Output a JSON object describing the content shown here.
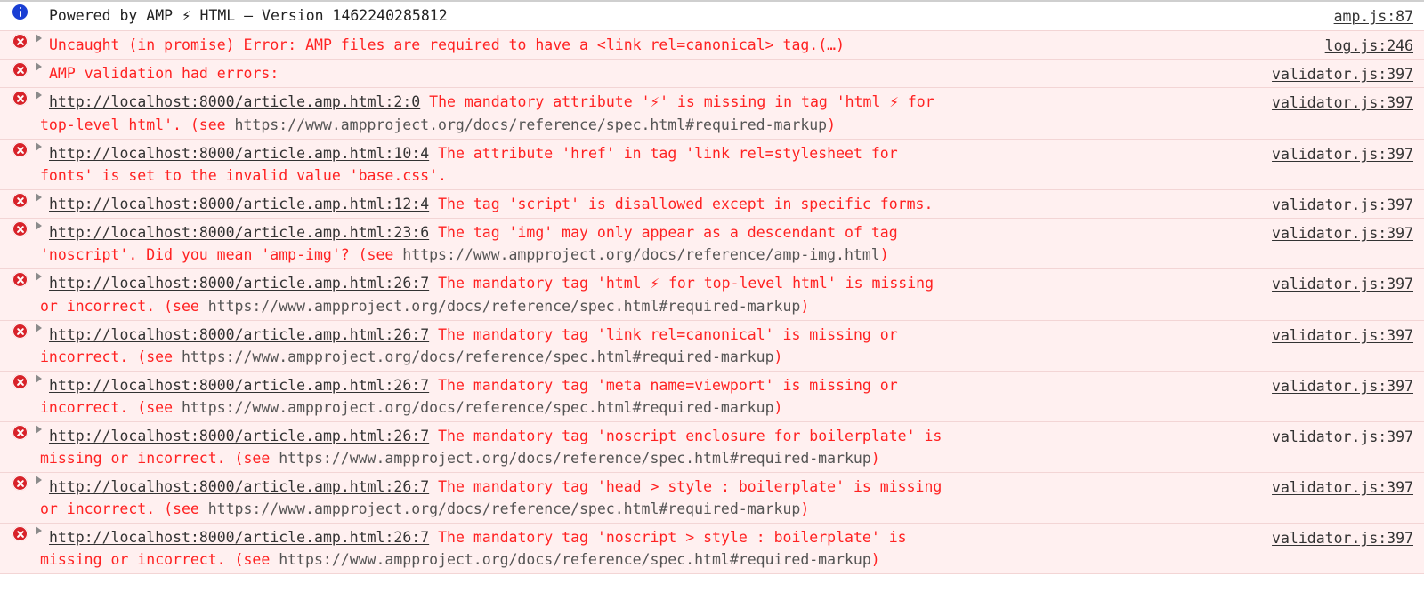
{
  "console": {
    "colors": {
      "error_text": "#ff2222",
      "error_row_bg": "#fff0f0",
      "info_row_bg": "#ffffff",
      "divider": "#f3d5d5",
      "error_icon": "#d8232a",
      "info_icon": "#1a3fd4",
      "link": "#333333",
      "disclosure": "#8b8b8b"
    },
    "icons": {
      "info": "info-circle-icon",
      "error": "error-circle-icon",
      "disclosure": "disclosure-triangle-icon"
    },
    "entries": [
      {
        "level": "info",
        "source": "amp.js:87",
        "has_disclosure": false,
        "lines": [
          [
            {
              "text": "Powered by AMP ",
              "style": "dark"
            },
            {
              "text": "⚡",
              "style": "dark-bolt"
            },
            {
              "text": " HTML – Version 1462240285812",
              "style": "dark"
            }
          ]
        ]
      },
      {
        "level": "error",
        "source": "log.js:246",
        "has_disclosure": true,
        "lines": [
          [
            {
              "text": "Uncaught (in promise) Error: AMP files are required to have a <link rel=canonical> tag.",
              "style": "red"
            },
            {
              "text": "(…)",
              "style": "red"
            }
          ]
        ]
      },
      {
        "level": "error",
        "source": "validator.js:397",
        "has_disclosure": true,
        "lines": [
          [
            {
              "text": "AMP validation had errors:",
              "style": "red"
            }
          ]
        ]
      },
      {
        "level": "error",
        "source": "validator.js:397",
        "has_disclosure": true,
        "lines": [
          [
            {
              "text": "http://localhost:8000/article.amp.html:2:0",
              "style": "link"
            },
            {
              "text": " The mandatory attribute '",
              "style": "red"
            },
            {
              "text": "⚡",
              "style": "red-bolt"
            },
            {
              "text": "' is missing in tag 'html ",
              "style": "red"
            },
            {
              "text": "⚡",
              "style": "red-bolt"
            },
            {
              "text": " for",
              "style": "red"
            }
          ],
          [
            {
              "text": "top-level html'. (see ",
              "style": "red"
            },
            {
              "text": "https://www.ampproject.org/docs/reference/spec.html#required-markup",
              "style": "gray"
            },
            {
              "text": ")",
              "style": "red"
            }
          ]
        ]
      },
      {
        "level": "error",
        "source": "validator.js:397",
        "has_disclosure": true,
        "lines": [
          [
            {
              "text": "http://localhost:8000/article.amp.html:10:4",
              "style": "link"
            },
            {
              "text": " The attribute 'href' in tag 'link rel=stylesheet for",
              "style": "red"
            }
          ],
          [
            {
              "text": "fonts' is set to the invalid value 'base.css'.",
              "style": "red"
            }
          ]
        ]
      },
      {
        "level": "error",
        "source": "validator.js:397",
        "has_disclosure": true,
        "lines": [
          [
            {
              "text": "http://localhost:8000/article.amp.html:12:4",
              "style": "link"
            },
            {
              "text": " The tag 'script' is disallowed except in specific forms.",
              "style": "red"
            }
          ]
        ]
      },
      {
        "level": "error",
        "source": "validator.js:397",
        "has_disclosure": true,
        "lines": [
          [
            {
              "text": "http://localhost:8000/article.amp.html:23:6",
              "style": "link"
            },
            {
              "text": " The tag 'img' may only appear as a descendant of tag",
              "style": "red"
            }
          ],
          [
            {
              "text": "'noscript'. Did you mean 'amp-img'? (see ",
              "style": "red"
            },
            {
              "text": "https://www.ampproject.org/docs/reference/amp-img.html",
              "style": "gray"
            },
            {
              "text": ")",
              "style": "red"
            }
          ]
        ]
      },
      {
        "level": "error",
        "source": "validator.js:397",
        "has_disclosure": true,
        "lines": [
          [
            {
              "text": "http://localhost:8000/article.amp.html:26:7",
              "style": "link"
            },
            {
              "text": " The mandatory tag 'html ",
              "style": "red"
            },
            {
              "text": "⚡",
              "style": "red-bolt"
            },
            {
              "text": " for top-level html' is missing",
              "style": "red"
            }
          ],
          [
            {
              "text": "or incorrect. (see ",
              "style": "red"
            },
            {
              "text": "https://www.ampproject.org/docs/reference/spec.html#required-markup",
              "style": "gray"
            },
            {
              "text": ")",
              "style": "red"
            }
          ]
        ]
      },
      {
        "level": "error",
        "source": "validator.js:397",
        "has_disclosure": true,
        "lines": [
          [
            {
              "text": "http://localhost:8000/article.amp.html:26:7",
              "style": "link"
            },
            {
              "text": " The mandatory tag 'link rel=canonical' is missing or",
              "style": "red"
            }
          ],
          [
            {
              "text": "incorrect. (see ",
              "style": "red"
            },
            {
              "text": "https://www.ampproject.org/docs/reference/spec.html#required-markup",
              "style": "gray"
            },
            {
              "text": ")",
              "style": "red"
            }
          ]
        ]
      },
      {
        "level": "error",
        "source": "validator.js:397",
        "has_disclosure": true,
        "lines": [
          [
            {
              "text": "http://localhost:8000/article.amp.html:26:7",
              "style": "link"
            },
            {
              "text": " The mandatory tag 'meta name=viewport' is missing or",
              "style": "red"
            }
          ],
          [
            {
              "text": "incorrect. (see ",
              "style": "red"
            },
            {
              "text": "https://www.ampproject.org/docs/reference/spec.html#required-markup",
              "style": "gray"
            },
            {
              "text": ")",
              "style": "red"
            }
          ]
        ]
      },
      {
        "level": "error",
        "source": "validator.js:397",
        "has_disclosure": true,
        "lines": [
          [
            {
              "text": "http://localhost:8000/article.amp.html:26:7",
              "style": "link"
            },
            {
              "text": " The mandatory tag 'noscript enclosure for boilerplate' is",
              "style": "red"
            }
          ],
          [
            {
              "text": "missing or incorrect. (see ",
              "style": "red"
            },
            {
              "text": "https://www.ampproject.org/docs/reference/spec.html#required-markup",
              "style": "gray"
            },
            {
              "text": ")",
              "style": "red"
            }
          ]
        ]
      },
      {
        "level": "error",
        "source": "validator.js:397",
        "has_disclosure": true,
        "lines": [
          [
            {
              "text": "http://localhost:8000/article.amp.html:26:7",
              "style": "link"
            },
            {
              "text": " The mandatory tag 'head > style : boilerplate' is missing",
              "style": "red"
            }
          ],
          [
            {
              "text": "or incorrect. (see ",
              "style": "red"
            },
            {
              "text": "https://www.ampproject.org/docs/reference/spec.html#required-markup",
              "style": "gray"
            },
            {
              "text": ")",
              "style": "red"
            }
          ]
        ]
      },
      {
        "level": "error",
        "source": "validator.js:397",
        "has_disclosure": true,
        "lines": [
          [
            {
              "text": "http://localhost:8000/article.amp.html:26:7",
              "style": "link"
            },
            {
              "text": " The mandatory tag 'noscript > style : boilerplate' is",
              "style": "red"
            }
          ],
          [
            {
              "text": "missing or incorrect. (see ",
              "style": "red"
            },
            {
              "text": "https://www.ampproject.org/docs/reference/spec.html#required-markup",
              "style": "gray"
            },
            {
              "text": ")",
              "style": "red"
            }
          ]
        ]
      }
    ]
  }
}
